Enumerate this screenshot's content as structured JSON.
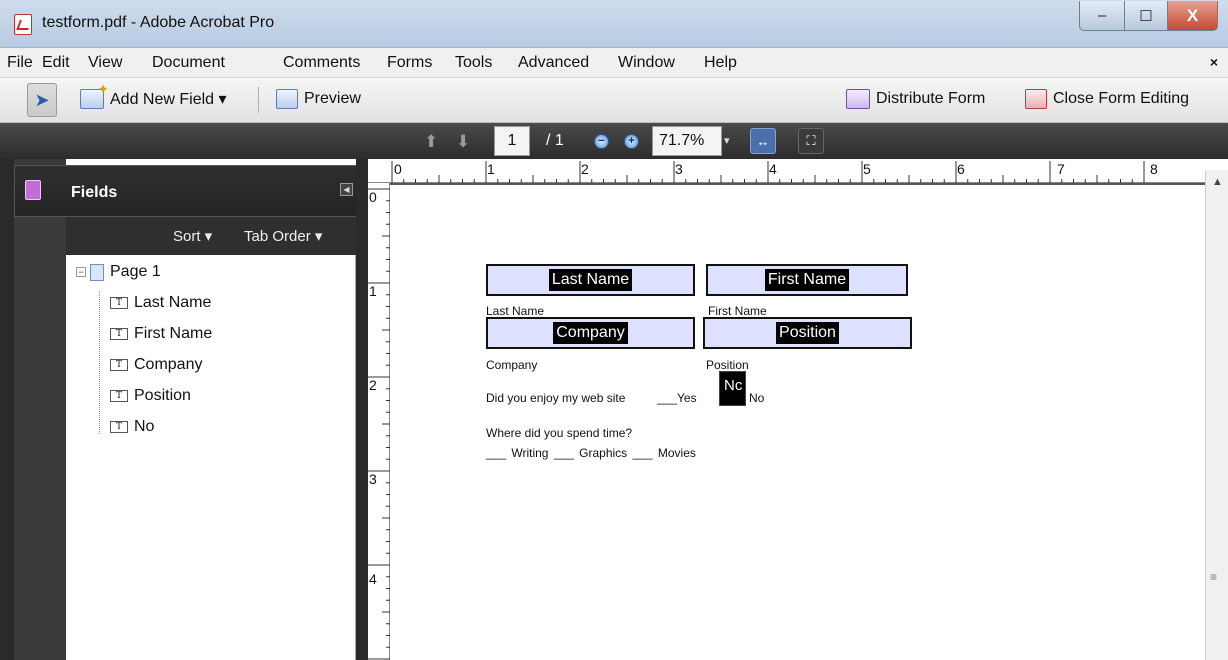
{
  "window": {
    "title": "testform.pdf - Adobe Acrobat Pro",
    "min": "–",
    "max": "☐",
    "close": "X"
  },
  "menubar": {
    "items": [
      "File",
      "Edit",
      "View",
      "Document",
      "Comments",
      "Forms",
      "Tools",
      "Advanced",
      "Window",
      "Help"
    ],
    "close": "×"
  },
  "toolbar": {
    "add_field": "Add New Field ▾",
    "preview": "Preview",
    "distribute": "Distribute Form",
    "close_editing": "Close Form Editing"
  },
  "navbar": {
    "page": "1",
    "page_total": "/ 1",
    "zoom": "71.7%",
    "zoom_dropdown": "▾"
  },
  "panel": {
    "title": "Fields",
    "sort": "Sort ▾",
    "tab_order": "Tab Order ▾",
    "tree": {
      "page": "Page 1",
      "fields": [
        "Last Name",
        "First Name",
        "Company",
        "Position",
        "No"
      ]
    }
  },
  "ruler": {
    "top": [
      "0",
      "1",
      "2",
      "3",
      "4",
      "5",
      "6",
      "7",
      "8"
    ],
    "left": [
      "0",
      "1",
      "2",
      "3",
      "4"
    ]
  },
  "form": {
    "fields": {
      "last_name": "Last Name",
      "first_name": "First Name",
      "company": "Company",
      "position": "Position",
      "no": "Nc"
    },
    "labels": {
      "last_name": "Last Name",
      "first_name": "First Name",
      "company": "Company",
      "position": "Position",
      "enjoy": "Did you enjoy my web site",
      "yes": "___Yes",
      "no": "No",
      "where": "Where did you spend time?",
      "options": "___ Writing ___ Graphics ___ Movies"
    }
  }
}
